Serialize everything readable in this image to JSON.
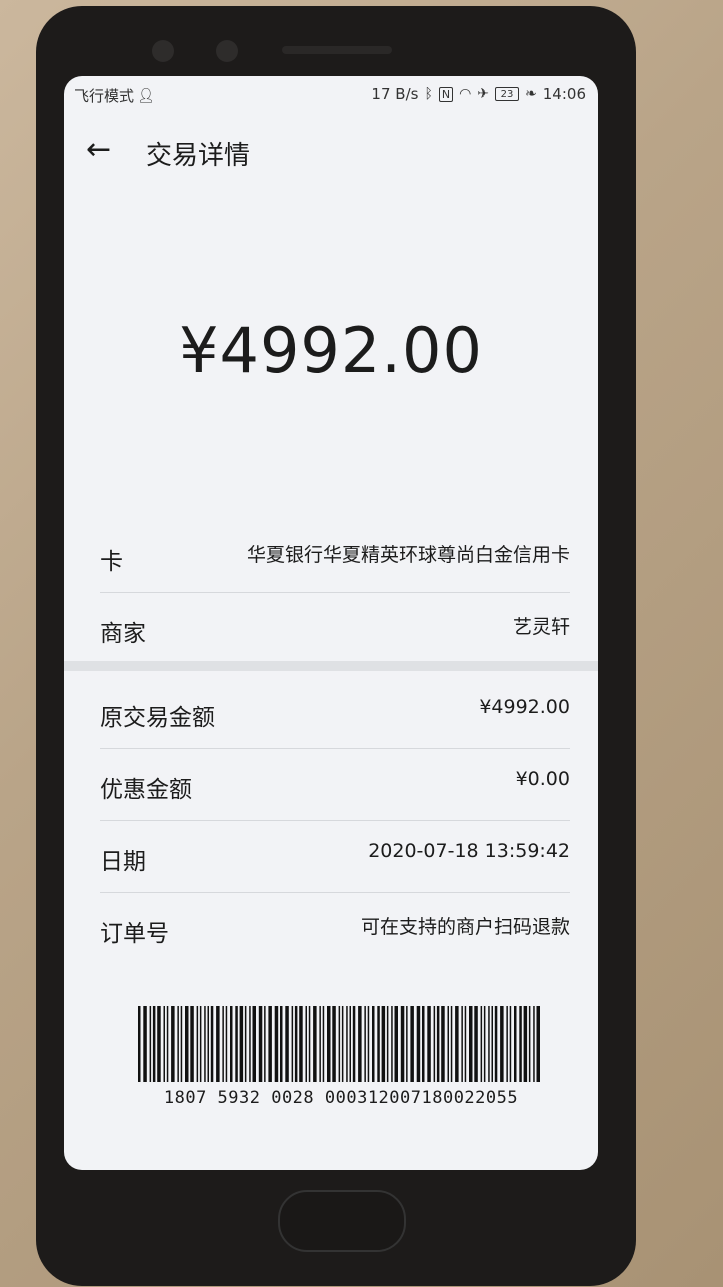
{
  "status": {
    "left_text": "飞行模式",
    "speed": "17 B/s",
    "battery": "23",
    "time": "14:06"
  },
  "header": {
    "back_icon": "arrow-left-icon",
    "title": "交易详情"
  },
  "amount": "¥4992.00",
  "details": [
    {
      "label": "卡",
      "value": "华夏银行华夏精英环球尊尚白金信用卡"
    },
    {
      "label": "商家",
      "value": "艺灵轩"
    },
    {
      "label": "原交易金额",
      "value": "¥4992.00"
    },
    {
      "label": "优惠金额",
      "value": "¥0.00"
    },
    {
      "label": "日期",
      "value": "2020-07-18 13:59:42"
    },
    {
      "label": "订单号",
      "value": "可在支持的商户扫码退款"
    }
  ],
  "barcode": {
    "number": "1807 5932 0028 000312007180022055"
  }
}
